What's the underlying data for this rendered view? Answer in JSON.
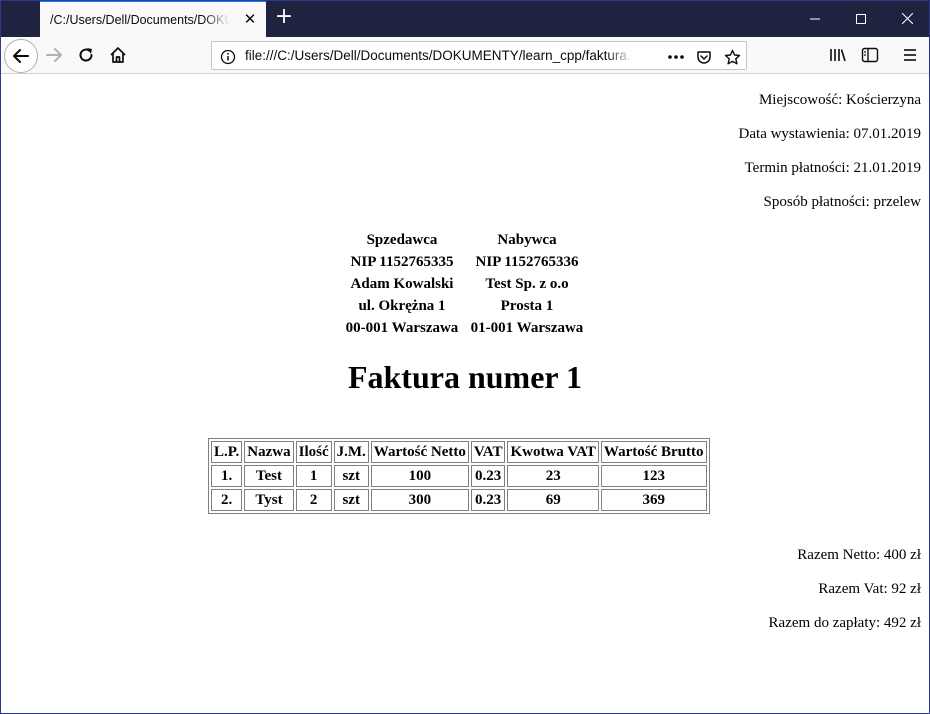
{
  "browser": {
    "tab_title": "/C:/Users/Dell/Documents/DOKUMENTY/learn_cpp/faktura.html",
    "tab_close_glyph": "✕",
    "new_tab_glyph": "+",
    "url": "file:///C:/Users/Dell/Documents/DOKUMENTY/learn_cpp/faktura.html",
    "colors": {
      "tabbar": "#202340",
      "accent": "#0a84ff"
    }
  },
  "invoice": {
    "place": "Miejscowość: Kościerzyna",
    "issue_date": "Data wystawienia: 07.01.2019",
    "due_date": "Termin płatności: 21.01.2019",
    "payment_method": "Sposób płatności: przelew",
    "seller": {
      "heading": "Spzedawca",
      "nip": "NIP 1152765335",
      "name": "Adam Kowalski",
      "street": "ul. Okrężna 1",
      "city": "00-001 Warszawa"
    },
    "buyer": {
      "heading": "Nabywca",
      "nip": "NIP 1152765336",
      "name": "Test Sp. z o.o",
      "street": "Prosta 1",
      "city": "01-001 Warszawa"
    },
    "title": "Faktura numer 1",
    "table": {
      "headers": [
        "L.P.",
        "Nazwa",
        "Ilość",
        "J.M.",
        "Wartość Netto",
        "VAT",
        "Kwotwa VAT",
        "Wartość Brutto"
      ],
      "rows": [
        [
          "1.",
          "Test",
          "1",
          "szt",
          "100",
          "0.23",
          "23",
          "123"
        ],
        [
          "2.",
          "Tyst",
          "2",
          "szt",
          "300",
          "0.23",
          "69",
          "369"
        ]
      ]
    },
    "totals": {
      "net": "Razem Netto: 400 zł",
      "vat": "Razem Vat: 92 zł",
      "gross": "Razem do zapłaty: 492 zł"
    }
  }
}
